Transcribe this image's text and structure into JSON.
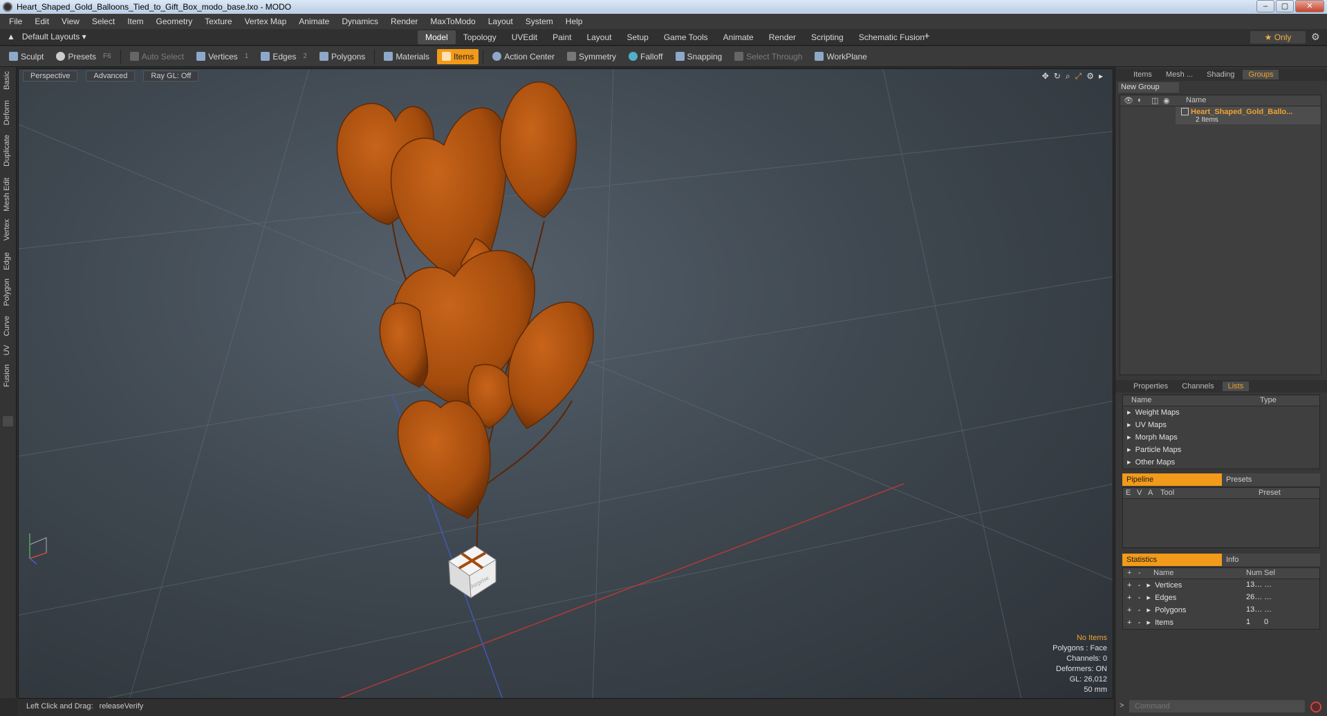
{
  "window": {
    "title": "Heart_Shaped_Gold_Balloons_Tied_to_Gift_Box_modo_base.lxo - MODO"
  },
  "menu": [
    "File",
    "Edit",
    "View",
    "Select",
    "Item",
    "Geometry",
    "Texture",
    "Vertex Map",
    "Animate",
    "Dynamics",
    "Render",
    "MaxToModo",
    "Layout",
    "System",
    "Help"
  ],
  "layout_selector": "Default Layouts ▾",
  "mode_tabs": [
    "Model",
    "Topology",
    "UVEdit",
    "Paint",
    "Layout",
    "Setup",
    "Game Tools",
    "Animate",
    "Render",
    "Scripting",
    "Schematic Fusion"
  ],
  "active_mode_tab": "Model",
  "only_label": "★  Only",
  "toolbar": {
    "sculpt": "Sculpt",
    "presets": "Presets",
    "presets_key": "F6",
    "auto_select": "Auto Select",
    "vertices": "Vertices",
    "vertices_key": "1",
    "edges": "Edges",
    "edges_key": "2",
    "polygons": "Polygons",
    "materials": "Materials",
    "items": "Items",
    "action_center": "Action Center",
    "symmetry": "Symmetry",
    "falloff": "Falloff",
    "snapping": "Snapping",
    "select_through": "Select Through",
    "workplane": "WorkPlane"
  },
  "left_tabs": [
    "Basic",
    "Deform",
    "Duplicate",
    "Mesh Edit",
    "Vertex",
    "Edge",
    "Polygon",
    "Curve",
    "UV",
    "Fusion"
  ],
  "viewport": {
    "view": "Perspective",
    "shading": "Advanced",
    "raygl": "Ray GL: Off",
    "box_label": "Surprise",
    "stats": {
      "items": "No Items",
      "polygons": "Polygons : Face",
      "channels": "Channels: 0",
      "deformers": "Deformers: ON",
      "gl": "GL: 26,012",
      "scale": "50 mm"
    }
  },
  "status": {
    "hint": "Left Click and Drag:",
    "action": "releaseVerify"
  },
  "right_panel": {
    "top_tabs": [
      "Items",
      "Mesh ...",
      "Shading",
      "Groups"
    ],
    "active_top_tab": "Groups",
    "new_group": "New Group",
    "groups_col_name": "Name",
    "group_item_name": "Heart_Shaped_Gold_Ballo...",
    "group_item_count": "2 Items",
    "mid_tabs": [
      "Properties",
      "Channels",
      "Lists"
    ],
    "active_mid_tab": "Lists",
    "lists_col_name": "Name",
    "lists_col_type": "Type",
    "lists": [
      "Weight Maps",
      "UV Maps",
      "Morph Maps",
      "Particle Maps",
      "Other Maps"
    ],
    "pipeline_tab": "Pipeline",
    "presets_tab": "Presets",
    "pipeline_cols": [
      "E",
      "V",
      "A",
      "Tool",
      "Preset"
    ],
    "statistics_tab": "Statistics",
    "info_tab": "Info",
    "stats_cols": [
      "Name",
      "Num",
      "Sel"
    ],
    "stats_rows": [
      {
        "name": "Vertices",
        "num": "13…",
        "sel": "…"
      },
      {
        "name": "Edges",
        "num": "26…",
        "sel": "…"
      },
      {
        "name": "Polygons",
        "num": "13…",
        "sel": "…"
      },
      {
        "name": "Items",
        "num": "1",
        "sel": "0"
      }
    ],
    "command_placeholder": "Command"
  },
  "colors": {
    "accent": "#f29a1a",
    "balloon": "#b5520f",
    "viewport": "#3f4850"
  }
}
